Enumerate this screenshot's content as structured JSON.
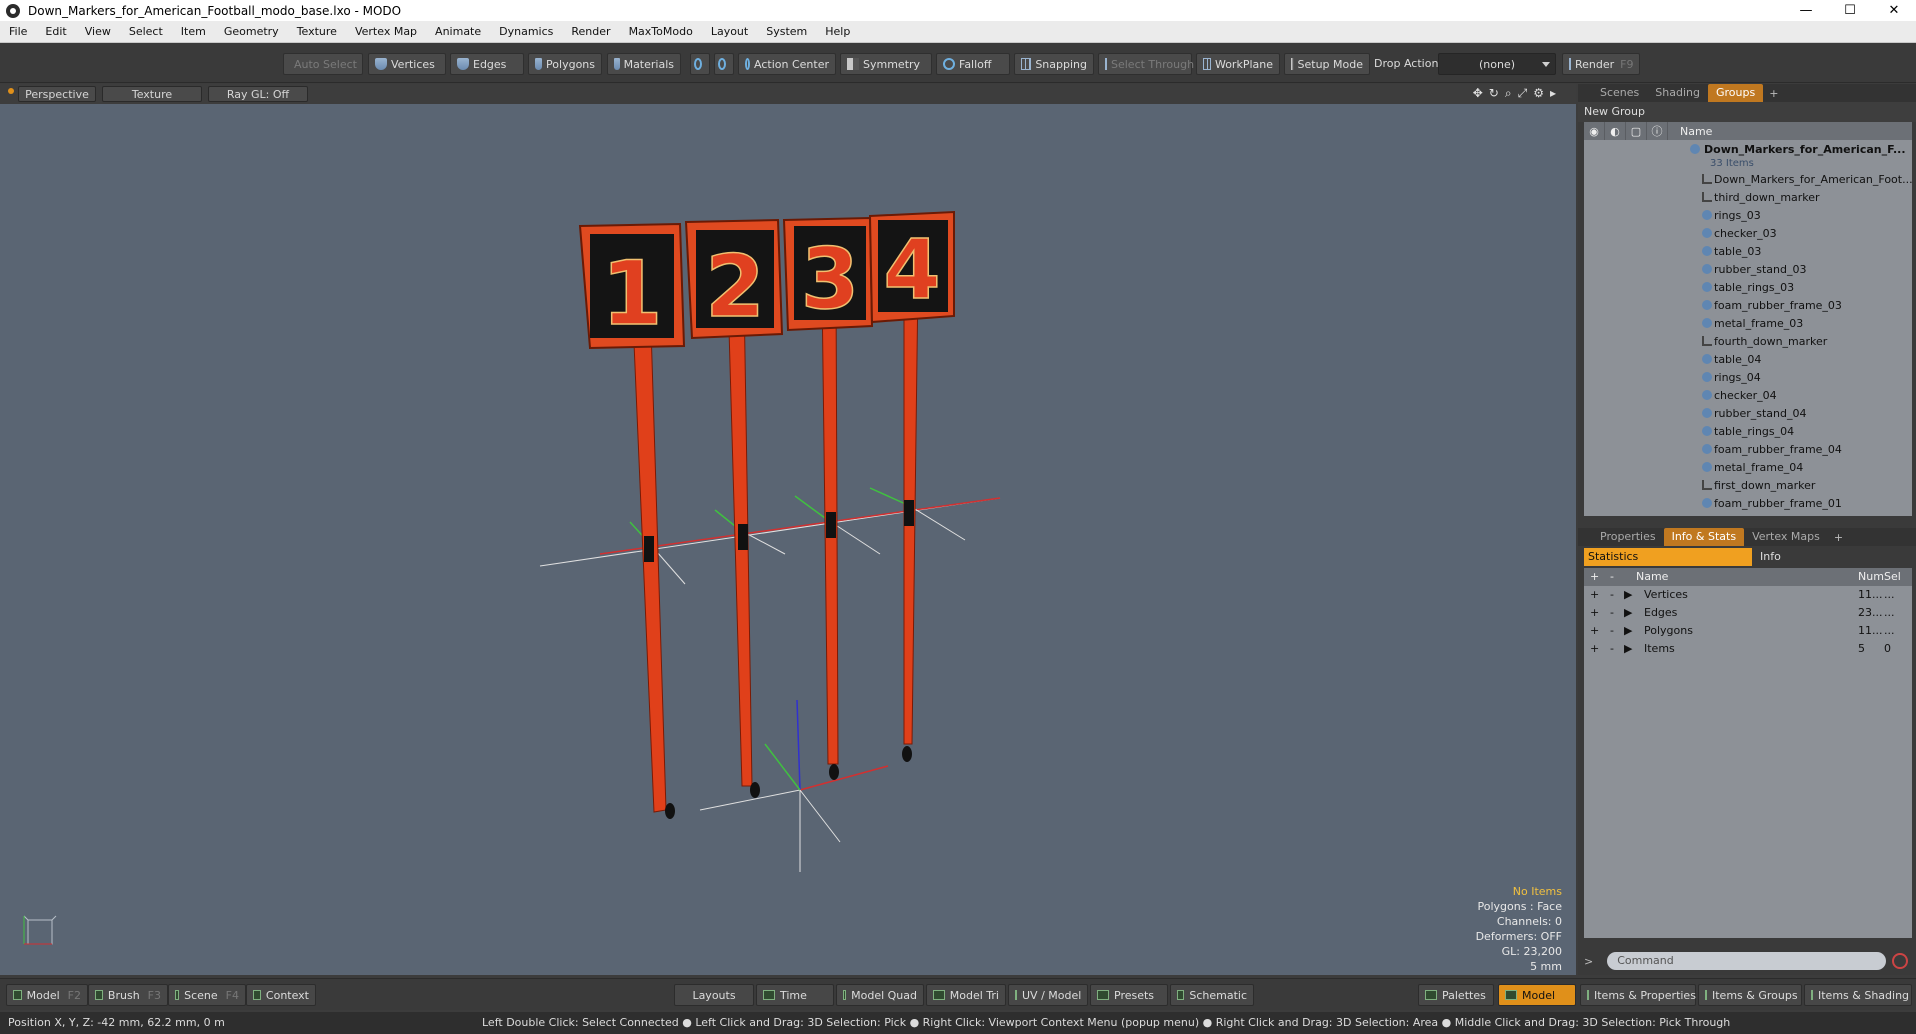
{
  "window": {
    "title": "Down_Markers_for_American_Football_modo_base.lxo - MODO",
    "minimize": "—",
    "maximize": "☐",
    "close": "✕"
  },
  "menu": [
    "File",
    "Edit",
    "View",
    "Select",
    "Item",
    "Geometry",
    "Texture",
    "Vertex Map",
    "Animate",
    "Dynamics",
    "Render",
    "MaxToModo",
    "Layout",
    "System",
    "Help"
  ],
  "toolbar": {
    "auto_select": "Auto Select",
    "vertices": "Vertices",
    "edges": "Edges",
    "polygons": "Polygons",
    "materials": "Materials",
    "action_center": "Action Center",
    "symmetry": "Symmetry",
    "falloff": "Falloff",
    "snapping": "Snapping",
    "select_through": "Select Through",
    "workplane": "WorkPlane",
    "setup_mode": "Setup Mode",
    "drop_action": "Drop Action",
    "drop_value": "(none)",
    "render": "Render",
    "render_key": "F9"
  },
  "viewport": {
    "tabs": [
      "Perspective",
      "Texture",
      "Ray GL: Off"
    ],
    "info": {
      "no_items": "No Items",
      "polygons": "Polygons : Face",
      "channels": "Channels: 0",
      "deformers": "Deformers: OFF",
      "gl": "GL: 23,200",
      "scale": "5 mm"
    },
    "markers": [
      "1",
      "2",
      "3",
      "4"
    ],
    "colors": {
      "background": "#5a6573",
      "pole": "#e0401a",
      "sign_bg": "#111111",
      "digit": "#e04020"
    }
  },
  "scene_panel": {
    "tabs": [
      "Scenes",
      "Shading",
      "Groups"
    ],
    "active_tab": "Groups",
    "new_group": "New Group",
    "name_header": "Name",
    "root": "Down_Markers_for_American_F...",
    "root_count": "33 Items",
    "items": [
      "Down_Markers_for_American_Foot...",
      "third_down_marker",
      "rings_03",
      "checker_03",
      "table_03",
      "rubber_stand_03",
      "table_rings_03",
      "foam_rubber_frame_03",
      "metal_frame_03",
      "fourth_down_marker",
      "table_04",
      "rings_04",
      "checker_04",
      "rubber_stand_04",
      "table_rings_04",
      "foam_rubber_frame_04",
      "metal_frame_04",
      "first_down_marker",
      "foam_rubber_frame_01"
    ]
  },
  "props_panel": {
    "tabs": [
      "Properties",
      "Info & Stats",
      "Vertex Maps"
    ],
    "active_tab": "Info & Stats",
    "subtabs": [
      "Statistics",
      "Info"
    ],
    "headers": {
      "name": "Name",
      "num": "Num",
      "sel": "Sel"
    },
    "rows": [
      {
        "name": "Vertices",
        "num": "11...",
        "sel": "..."
      },
      {
        "name": "Edges",
        "num": "23...",
        "sel": "..."
      },
      {
        "name": "Polygons",
        "num": "11...",
        "sel": "..."
      },
      {
        "name": "Items",
        "num": "5",
        "sel": "0"
      }
    ],
    "command_placeholder": "Command"
  },
  "bottom": {
    "left": [
      {
        "label": "Model",
        "key": "F2"
      },
      {
        "label": "Brush",
        "key": "F3"
      },
      {
        "label": "Scene",
        "key": "F4"
      },
      {
        "label": "Context",
        "key": ""
      }
    ],
    "center": [
      "Layouts",
      "Time",
      "Model Quad",
      "Model Tri",
      "UV / Model",
      "Presets",
      "Schematic"
    ],
    "right": [
      "Palettes",
      "Model",
      "Items & Properties",
      "Items & Groups",
      "Items & Shading"
    ]
  },
  "status": {
    "position": "Position X, Y, Z:   -42 mm, 62.2 mm, 0 m",
    "hints": "Left Double Click: Select Connected ● Left Click and Drag: 3D Selection: Pick ● Right Click: Viewport Context Menu (popup menu) ● Right Click and Drag: 3D Selection: Area ● Middle Click and Drag: 3D Selection: Pick Through"
  }
}
